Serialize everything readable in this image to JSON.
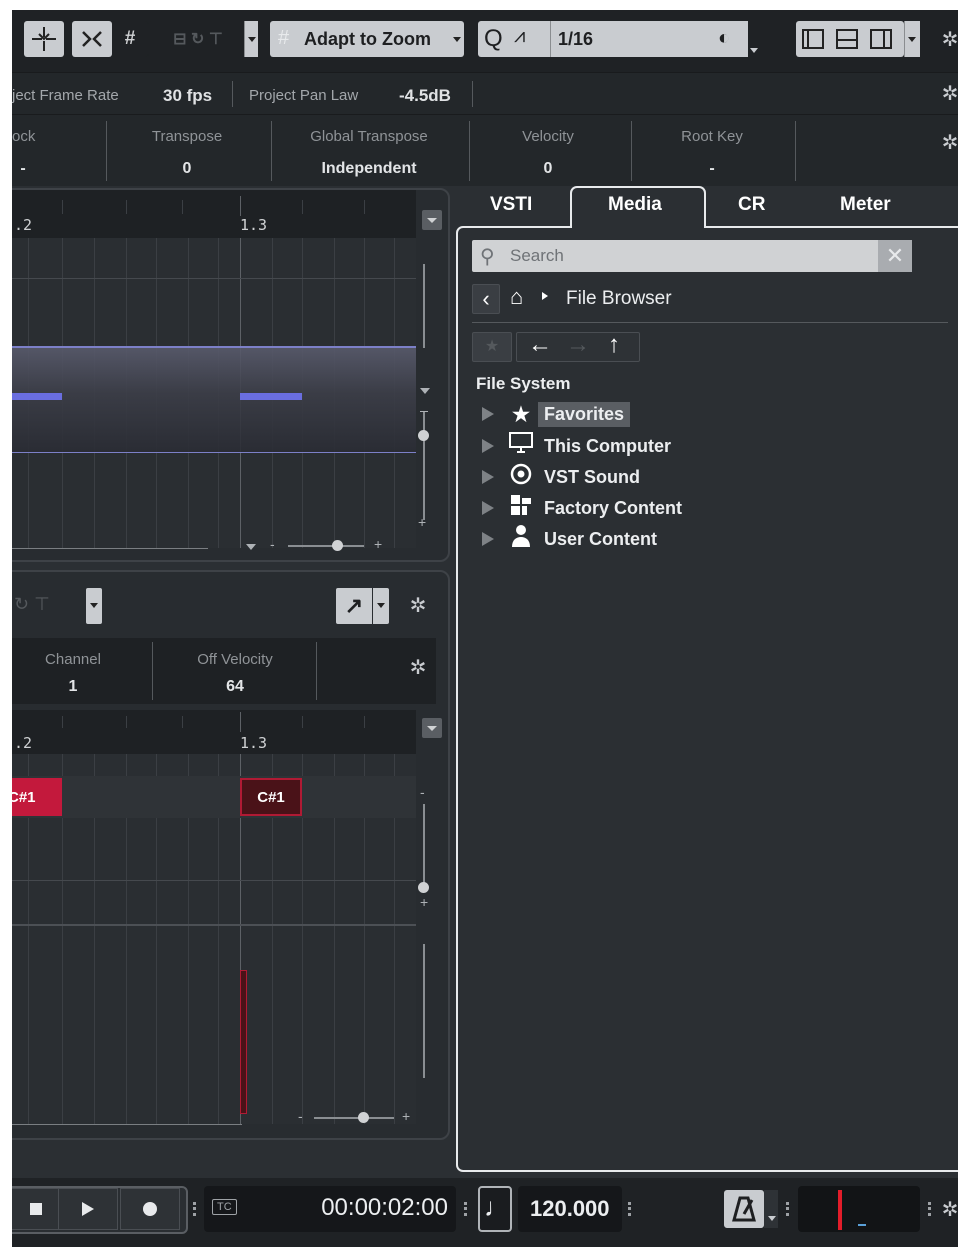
{
  "toolbar": {
    "adapt_label": "Adapt to Zoom",
    "quant_q": "Q",
    "quant_value": "1/16"
  },
  "info1": {
    "frame_rate_label": "ject Frame Rate",
    "frame_rate_value": "30 fps",
    "pan_law_label": "Project Pan Law",
    "pan_law_value": "-4.5dB"
  },
  "info2": {
    "cols": [
      {
        "label": "ock",
        "value": "-"
      },
      {
        "label": "Transpose",
        "value": "0"
      },
      {
        "label": "Global Transpose",
        "value": "Independent"
      },
      {
        "label": "Velocity",
        "value": "0"
      },
      {
        "label": "Root Key",
        "value": "-"
      }
    ]
  },
  "editor_top": {
    "ruler_labels": [
      ".2",
      "1.3"
    ]
  },
  "editor_bottom": {
    "channel_label": "Channel",
    "channel_value": "1",
    "off_velocity_label": "Off Velocity",
    "off_velocity_value": "64",
    "ruler_labels": [
      ".2",
      "1.3"
    ],
    "notes": [
      "C#1",
      "C#1"
    ]
  },
  "zone": {
    "tabs": [
      "VSTI",
      "Media",
      "CR",
      "Meter"
    ],
    "active_tab": "Media",
    "search_placeholder": "Search",
    "breadcrumb": "File Browser",
    "tree_header": "File System",
    "tree": [
      {
        "label": "Favorites",
        "icon": "star-icon"
      },
      {
        "label": "This Computer",
        "icon": "monitor-icon"
      },
      {
        "label": "VST Sound",
        "icon": "vst-sound-icon"
      },
      {
        "label": "Factory Content",
        "icon": "factory-content-icon"
      },
      {
        "label": "User Content",
        "icon": "user-icon"
      }
    ]
  },
  "transport": {
    "timecode_badge": "TC",
    "time": "00:00:02:00",
    "tempo": "120.000"
  },
  "colors": {
    "background": "#2b2f33",
    "note_red": "#c3193c",
    "velocity_bar": "#6a6ee0",
    "zone_border": "#e8eaec"
  }
}
